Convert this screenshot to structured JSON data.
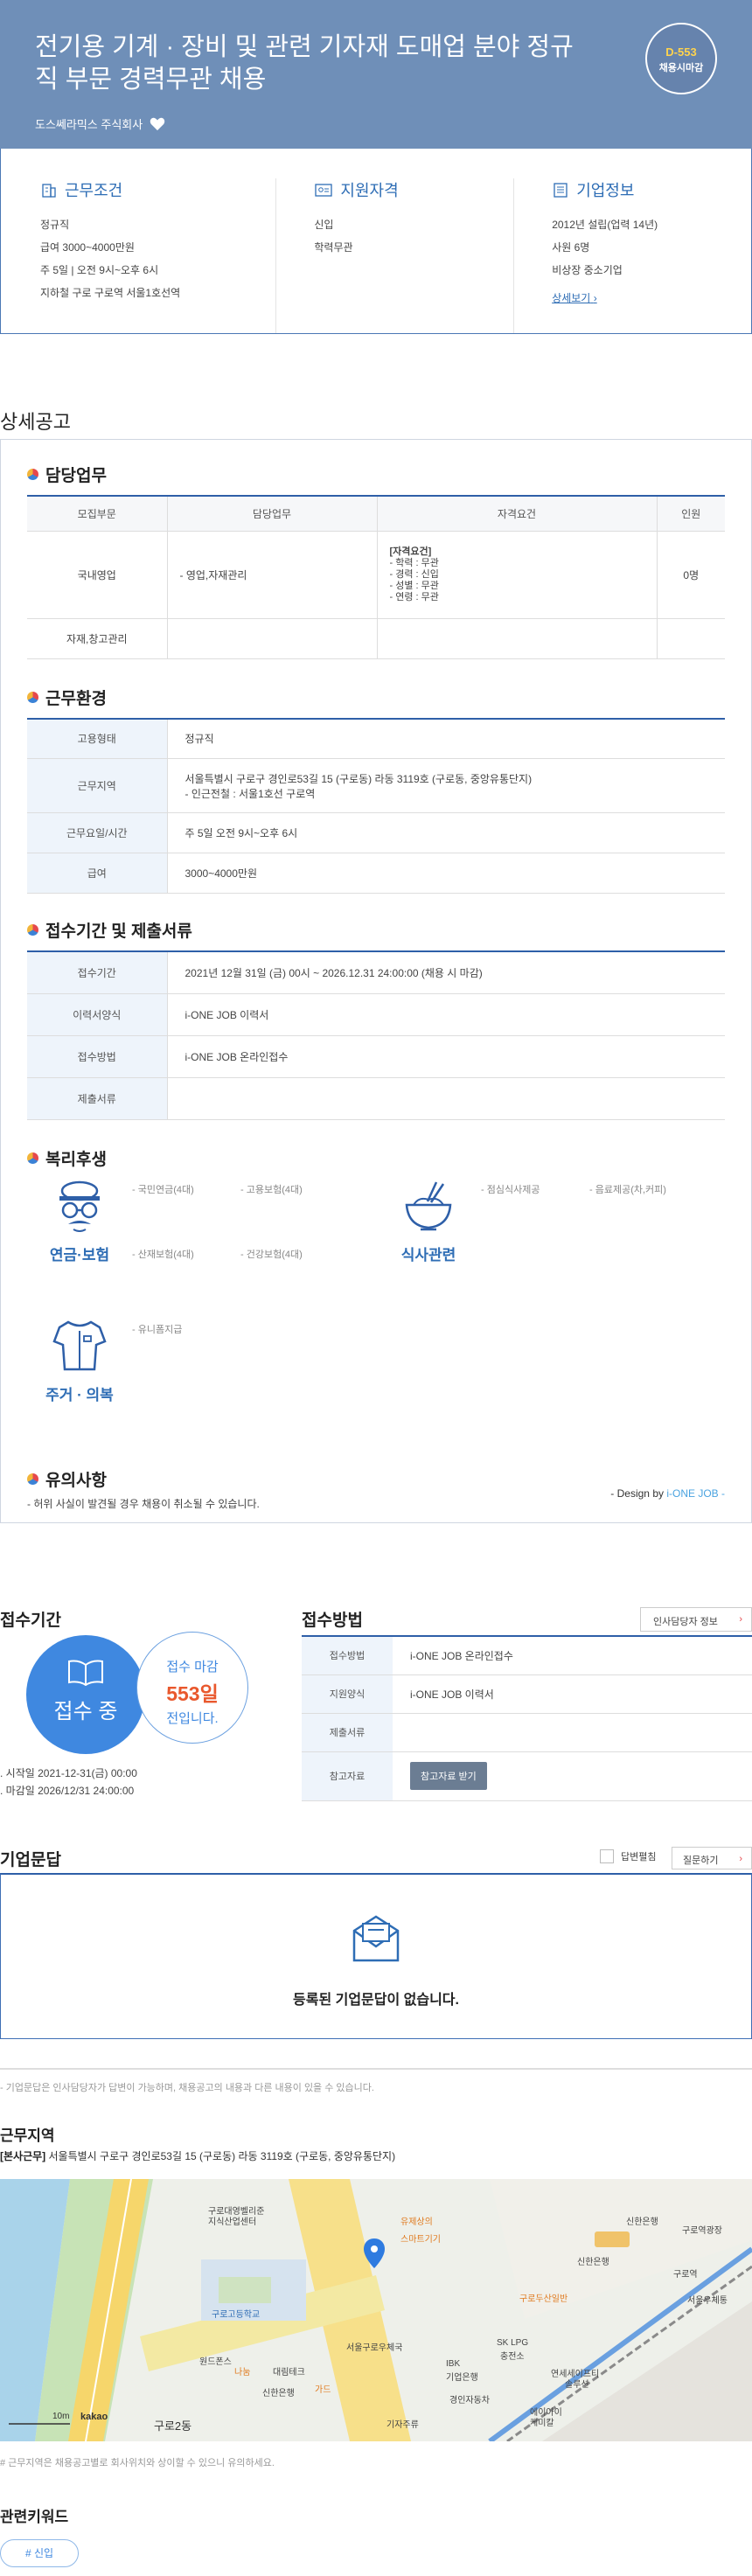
{
  "header": {
    "title": "전기용 기계 · 장비 및 관련 기자재 도매업 분야 정규직 부문 경력무관 채용",
    "company": "도스쎄라믹스 주식회사",
    "dday": "D-553",
    "dday_label": "채용시마감"
  },
  "summary": {
    "work": {
      "title": "근무조건",
      "items": [
        "정규직",
        "급여 3000~4000만원",
        "주 5일 | 오전 9시~오후 6시",
        "지하철 구로 구로역 서울1호선역"
      ]
    },
    "qual": {
      "title": "지원자격",
      "items": [
        "신입",
        "학력무관"
      ]
    },
    "company": {
      "title": "기업정보",
      "items": [
        "2012년 설립(업력 14년)",
        "사원 6명",
        "비상장 중소기업"
      ],
      "more": "상세보기"
    }
  },
  "detail": {
    "title": "상세공고",
    "duty": {
      "title": "담당업무",
      "headers": [
        "모집부문",
        "담당업무",
        "자격요건",
        "인원"
      ],
      "rows": [
        {
          "dept": "국내영업",
          "task": "- 영업,자재관리",
          "req_title": "[자격요건]",
          "req": [
            "- 학력 : 무관",
            "- 경력 : 신입",
            "- 성별 : 무관",
            "- 연령 : 무관"
          ],
          "count": "0명"
        },
        {
          "dept": "자재,창고관리",
          "task": "",
          "req_title": "",
          "req": [],
          "count": ""
        }
      ]
    },
    "env": {
      "title": "근무환경",
      "rows": [
        {
          "k": "고용형태",
          "v": "정규직",
          "v2": ""
        },
        {
          "k": "근무지역",
          "v": "서울특별시 구로구 경인로53길 15 (구로동) 라동 3119호 (구로동, 중앙유통단지)",
          "v2": "- 인근전철 : 서울1호선 구로역"
        },
        {
          "k": "근무요일/시간",
          "v": "주 5일 오전 9시~오후 6시",
          "v2": ""
        },
        {
          "k": "급여",
          "v": "3000~4000만원",
          "v2": ""
        }
      ]
    },
    "apply": {
      "title": "접수기간 및 제출서류",
      "rows": [
        {
          "k": "접수기간",
          "v": "2021년 12월 31일 (금) 00시 ~ 2026.12.31 24:00:00 (채용 시 마감)"
        },
        {
          "k": "이력서양식",
          "v": "i-ONE JOB 이력서"
        },
        {
          "k": "접수방법",
          "v": "i-ONE JOB 온라인접수"
        },
        {
          "k": "제출서류",
          "v": ""
        }
      ]
    },
    "welfare": {
      "title": "복리후생",
      "groups": [
        {
          "label": "연금·보험",
          "items": [
            "- 국민연금(4대)",
            "- 고용보험(4대)",
            "- 산재보험(4대)",
            "- 건강보험(4대)"
          ]
        },
        {
          "label": "식사관련",
          "items": [
            "- 점심식사제공",
            "- 음료제공(차,커피)"
          ]
        },
        {
          "label": "주거 · 의복",
          "items": [
            "- 유니폼지급"
          ]
        }
      ]
    },
    "caution": {
      "title": "유의사항",
      "text": "- 허위 사실이 발견될 경우 채용이 취소될 수 있습니다."
    },
    "design_prefix": "- Design by ",
    "design_brand": "i-ONE JOB -"
  },
  "period": {
    "title": "접수기간",
    "status": "접수 중",
    "deadline_label": "접수 마감",
    "days": "553일",
    "remain": "전입니다.",
    "start": "시작일 2021-12-31(금) 00:00",
    "end": "마감일 2026/12/31 24:00:00"
  },
  "method": {
    "title": "접수방법",
    "hr_button": "인사담당자 정보",
    "rows": [
      {
        "k": "접수방법",
        "v": "i-ONE JOB 온라인접수"
      },
      {
        "k": "지원양식",
        "v": "i-ONE JOB 이력서"
      },
      {
        "k": "제출서류",
        "v": ""
      },
      {
        "k": "참고자료",
        "v": ""
      }
    ],
    "ref_button": "참고자료 받기"
  },
  "qa": {
    "title": "기업문답",
    "checkbox_label": "답변펼침",
    "ask_button": "질문하기",
    "empty": "등록된 기업문답이 없습니다.",
    "note": "- 기업문답은 인사담당자가 답변이 가능하며, 채용공고의 내용과 다른 내용이 있을 수 있습니다."
  },
  "location": {
    "title": "근무지역",
    "tag": "[본사근무]",
    "address": "서울특별시 구로구 경인로53길 15 (구로동) 라동 3119호 (구로동, 중앙유통단지)",
    "map_labels": [
      "구로대영벨리준",
      "지식산업센터",
      "구로고등학교",
      "원드폰스",
      "대림테크",
      "서울구로우체국",
      "기자주류",
      "SK LPG",
      "충전소",
      "신한은행",
      "구로두산일반",
      "스마트기기",
      "가드",
      "유제상의",
      "구로2동",
      "서울우체통",
      "구로역광장",
      "신한은행",
      "IBK",
      "기업은행",
      "경인자동차",
      "구로역",
      "나눔",
      "신한은행",
      "에이아이",
      "케미칼",
      "연세세이프티",
      "솔루션"
    ],
    "map_scale": "10m",
    "map_brand": "kakao",
    "note": "# 근무지역은 채용공고별로 회사위치와 상이할 수 있으니 유의하세요."
  },
  "keywords": {
    "title": "관련키워드",
    "items": [
      "# 신입"
    ]
  }
}
